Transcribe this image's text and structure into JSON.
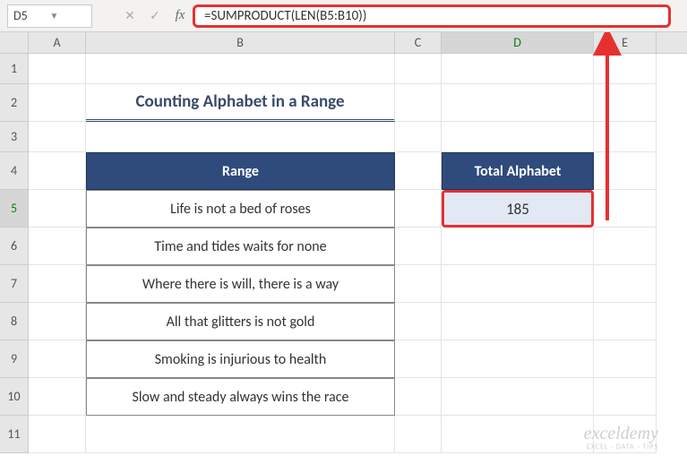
{
  "formula_bar": {
    "cell_ref": "D5",
    "formula": "=SUMPRODUCT(LEN(B5:B10))"
  },
  "columns": [
    "A",
    "B",
    "C",
    "D",
    "E"
  ],
  "row_nums": [
    "1",
    "2",
    "3",
    "4",
    "5",
    "6",
    "7",
    "8",
    "9",
    "10",
    "11"
  ],
  "title": "Counting Alphabet in a Range",
  "headers": {
    "range": "Range",
    "total": "Total Alphabet"
  },
  "range_data": [
    "Life is not a bed of roses",
    "Time and tides waits for none",
    "Where there is will, there is a way",
    "All that glitters is not gold",
    "Smoking is injurious to health",
    "Slow and steady always wins the race"
  ],
  "result": "185",
  "watermark": {
    "name": "exceldemy",
    "tag": "EXCEL · DATA · TIPS"
  }
}
